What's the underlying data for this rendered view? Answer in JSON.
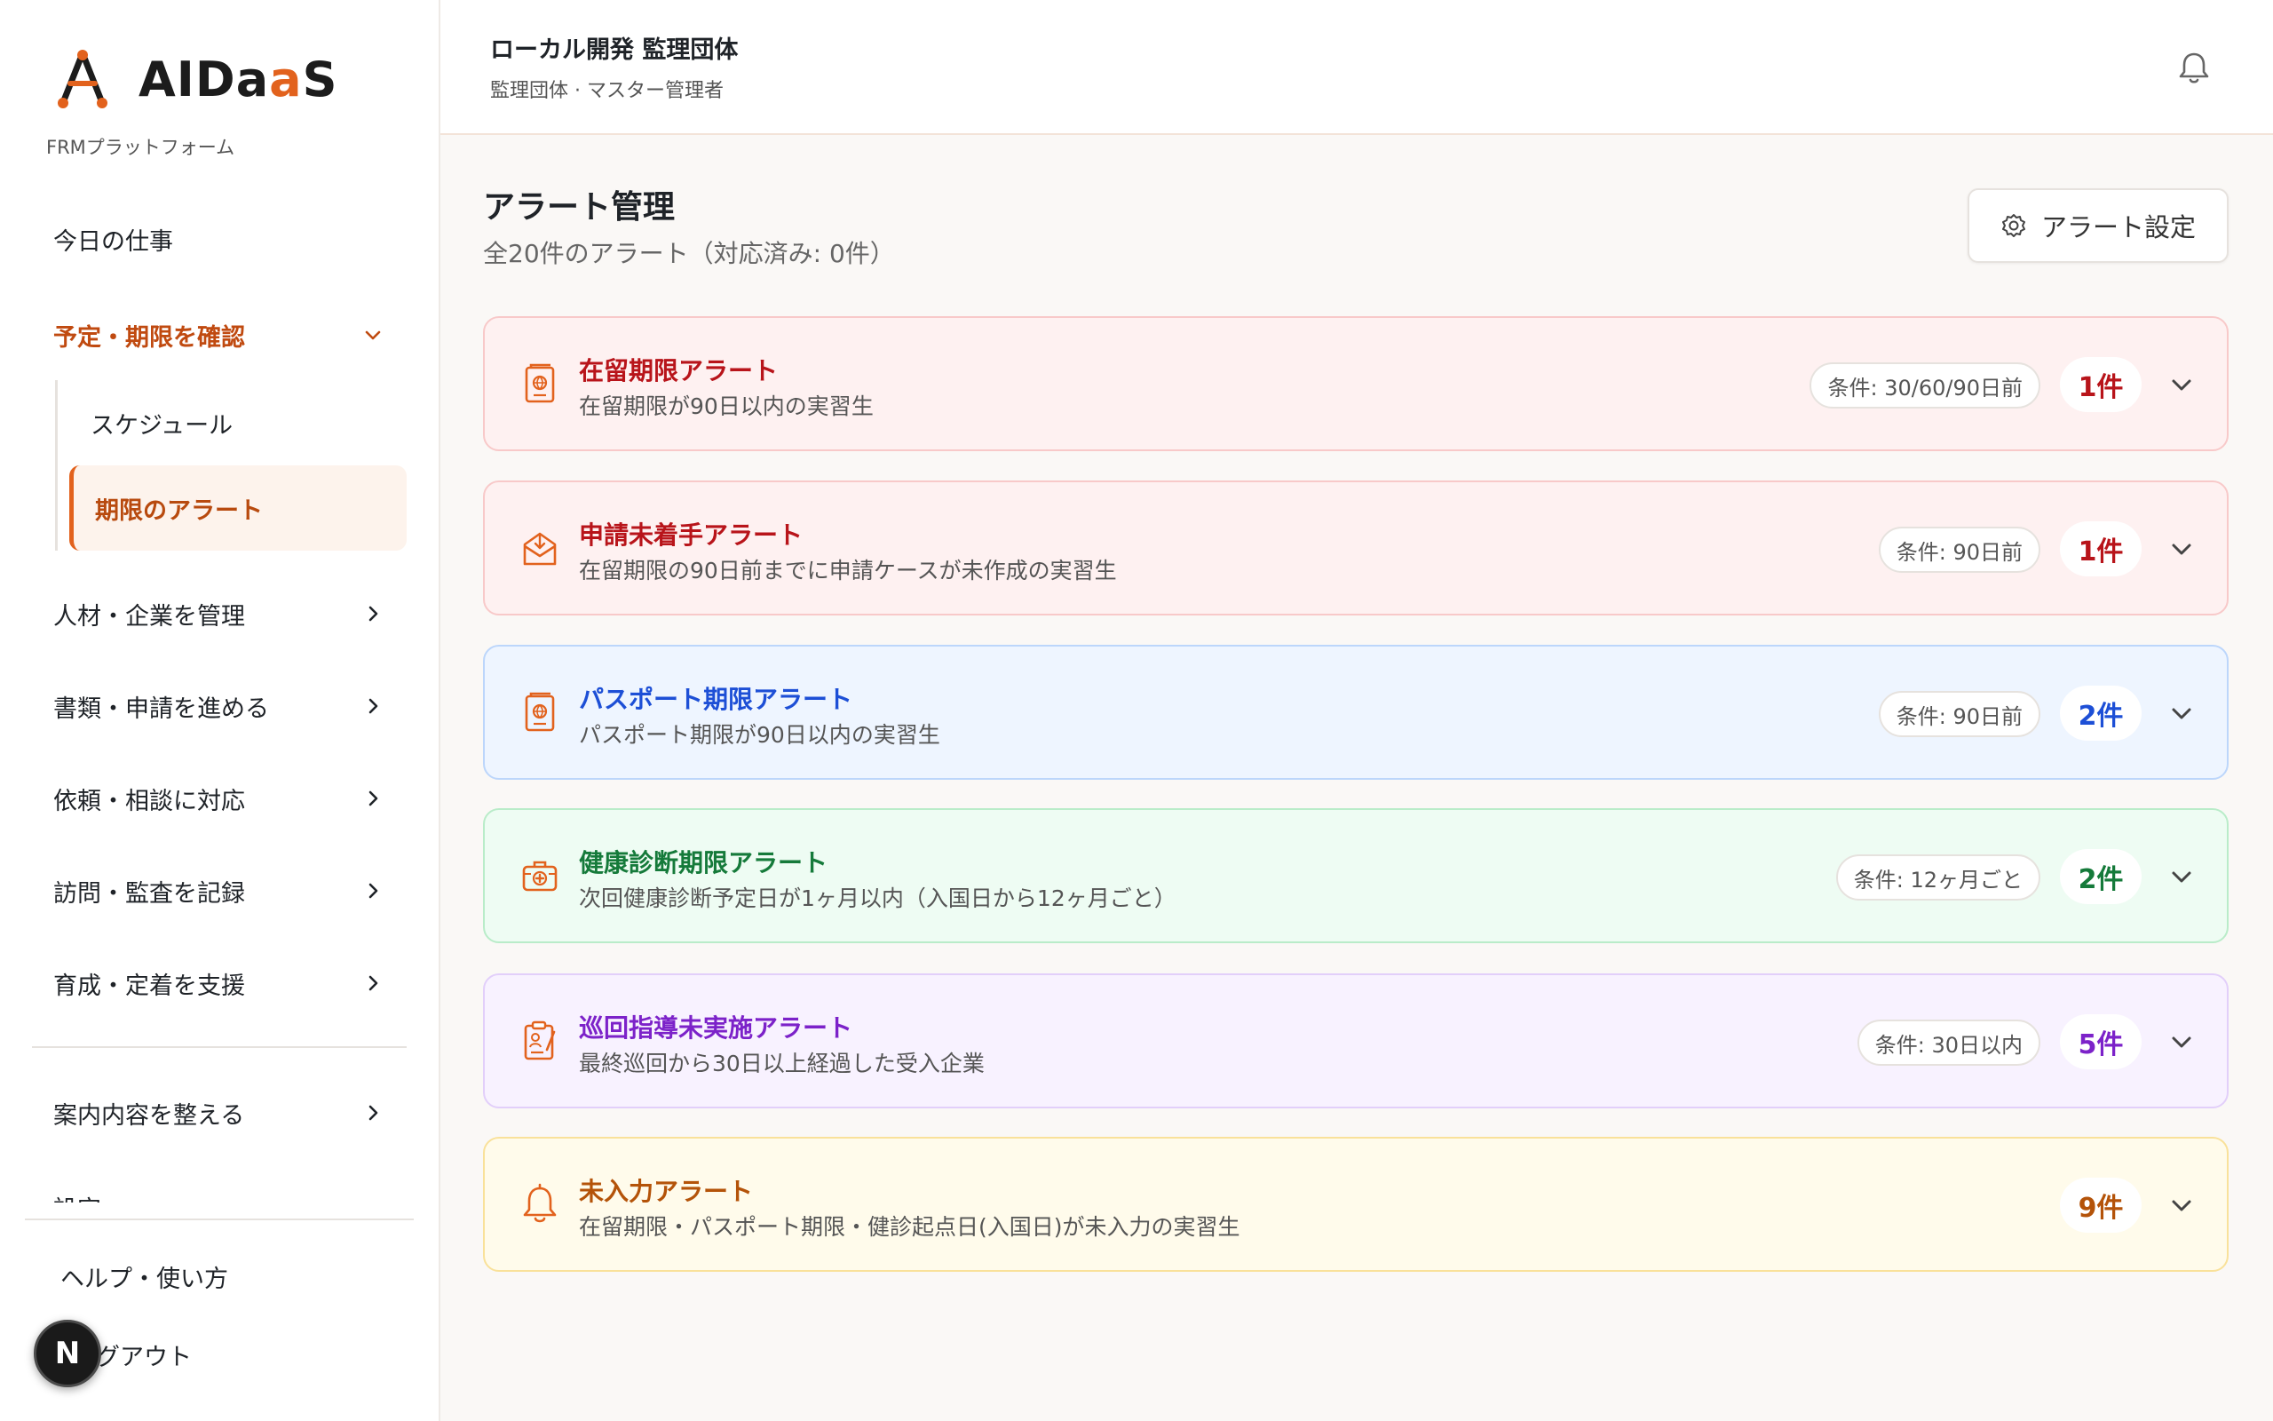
{
  "brand": {
    "logo_text_main": "AIDa",
    "logo_text_accent": "a",
    "logo_text_tail": "S",
    "platform": "FRMプラットフォーム",
    "accent_color": "#e2621d"
  },
  "sidebar": {
    "items": [
      {
        "label": "今日の仕事"
      },
      {
        "label": "予定・期限を確認"
      },
      {
        "label": "人材・企業を管理"
      },
      {
        "label": "書類・申請を進める"
      },
      {
        "label": "依頼・相談に対応"
      },
      {
        "label": "訪問・監査を記録"
      },
      {
        "label": "育成・定着を支援"
      },
      {
        "label": "案内内容を整える"
      },
      {
        "label": "設定"
      }
    ],
    "subitems": [
      {
        "label": "スケジュール"
      },
      {
        "label": "期限のアラート"
      }
    ],
    "bottom": {
      "help": "ヘルプ・使い方",
      "logout": "グアウト",
      "badge": "N"
    }
  },
  "header": {
    "org_name": "ローカル開発 監理団体",
    "org_role": "監理団体 · マスター管理者"
  },
  "main": {
    "title": "アラート管理",
    "subtitle": "全20件のアラート（対応済み: 0件）",
    "settings_button": "アラート設定",
    "alerts": [
      {
        "title": "在留期限アラート",
        "desc": "在留期限が90日以内の実習生",
        "condition": "条件: 30/60/90日前",
        "count": "1件",
        "icon": "passport-icon",
        "color": "#b8141a"
      },
      {
        "title": "申請未着手アラート",
        "desc": "在留期限の90日前までに申請ケースが未作成の実習生",
        "condition": "条件: 90日前",
        "count": "1件",
        "icon": "mail-icon",
        "color": "#b8141a"
      },
      {
        "title": "パスポート期限アラート",
        "desc": "パスポート期限が90日以内の実習生",
        "condition": "条件: 90日前",
        "count": "2件",
        "icon": "passport-icon",
        "color": "#1d4fd6"
      },
      {
        "title": "健康診断期限アラート",
        "desc": "次回健康診断予定日が1ヶ月以内（入国日から12ヶ月ごと）",
        "condition": "条件: 12ヶ月ごと",
        "count": "2件",
        "icon": "medical-kit-icon",
        "color": "#157a3a"
      },
      {
        "title": "巡回指導未実施アラート",
        "desc": "最終巡回から30日以上経過した受入企業",
        "condition": "条件: 30日以内",
        "count": "5件",
        "icon": "clipboard-icon",
        "color": "#7c22c9"
      },
      {
        "title": "未入力アラート",
        "desc": "在留期限・パスポート期限・健診起点日(入国日)が未入力の実習生",
        "condition": "",
        "count": "9件",
        "icon": "bell-icon",
        "color": "#b45309"
      }
    ]
  }
}
